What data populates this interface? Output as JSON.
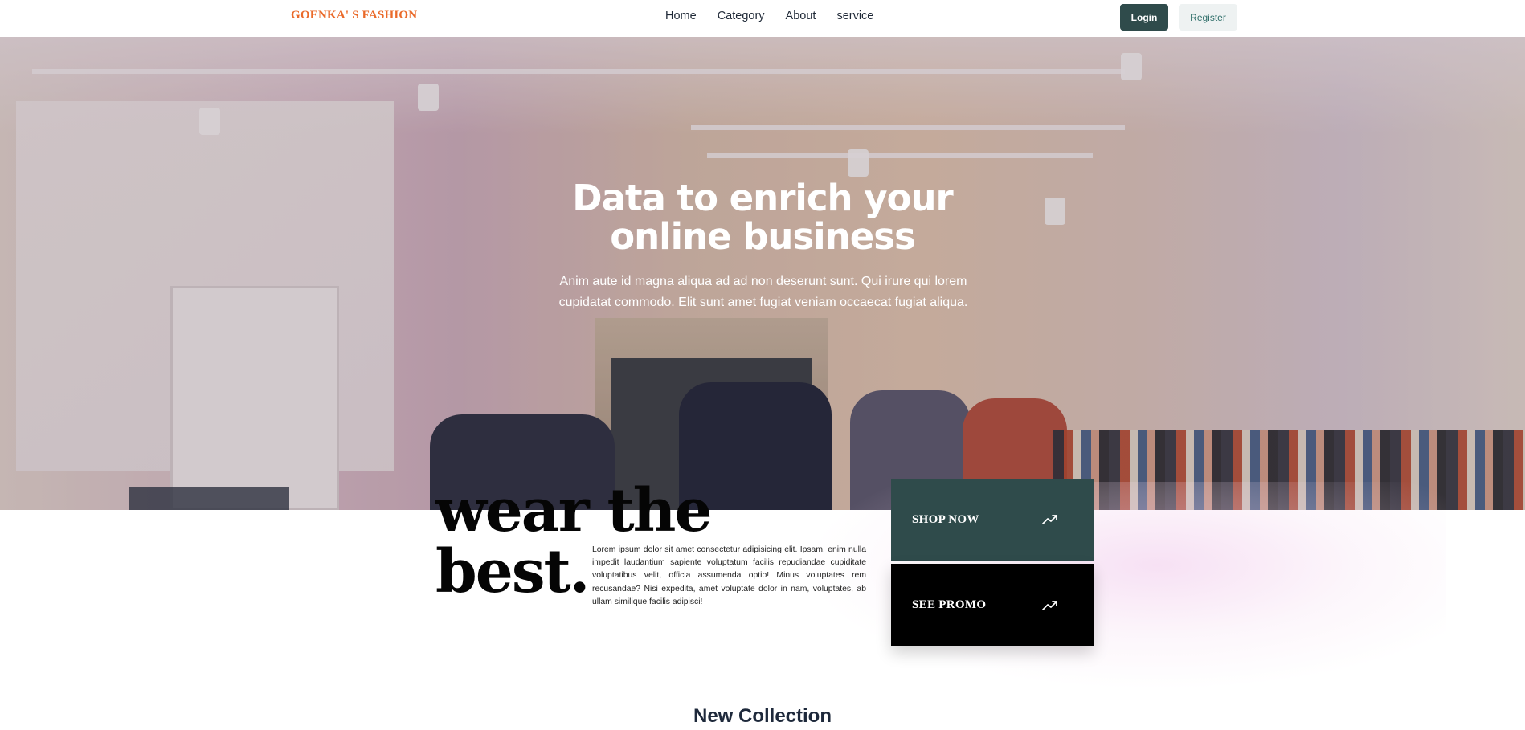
{
  "nav": {
    "brand": "GOENKA' S FASHION",
    "links": [
      "Home",
      "Category",
      "About",
      "service"
    ],
    "login_label": "Login",
    "register_label": "Register"
  },
  "hero": {
    "title_line1": "Data to enrich your",
    "title_line2": "online business",
    "subtitle": "Anim aute id magna aliqua ad ad non deserunt sunt. Qui irure qui lorem cupidatat commodo. Elit sunt amet fugiat veniam occaecat fugiat aliqua."
  },
  "promo": {
    "headline_line1": "wear the",
    "headline_line2": "best.",
    "description": "Lorem ipsum dolor sit amet consectetur adipisicing elit. Ipsam, enim nulla impedit laudantium sapiente voluptatum facilis repudiandae cupiditate voluptatibus velit, officia assumenda optio! Minus voluptates rem recusandae? Nisi expedita, amet voluptate dolor in nam, voluptates, ab ullam similique facilis adipisci!",
    "shop_now_label": "SHOP NOW",
    "see_promo_label": "SEE PROMO",
    "arrow_icon": "trending-up-icon"
  },
  "collection": {
    "title": "New Collection"
  },
  "colors": {
    "brand": "#ea6a2a",
    "accent_dark_green": "#2f4b4b",
    "register_bg": "#eef2f2",
    "promo_black": "#000000"
  }
}
